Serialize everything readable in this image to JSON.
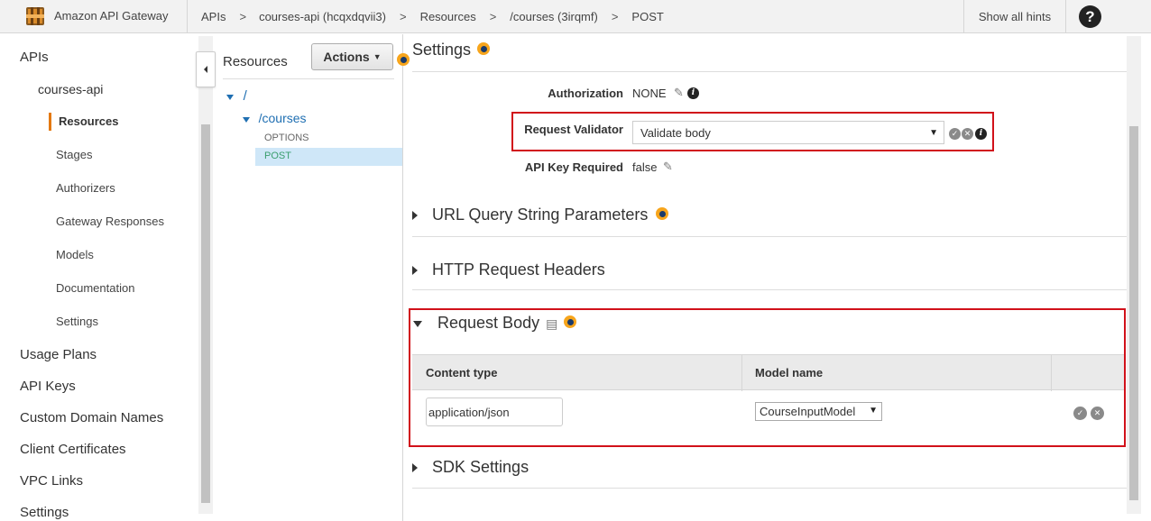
{
  "topbar": {
    "brand": "Amazon API Gateway",
    "breadcrumbs": [
      "APIs",
      "courses-api (hcqxdqvii3)",
      "Resources",
      "/courses (3irqmf)",
      "POST"
    ],
    "separator": ">",
    "show_hints": "Show all hints",
    "help": "?"
  },
  "sidebar": {
    "apis": "APIs",
    "api_name": "courses-api",
    "items": [
      "Resources",
      "Stages",
      "Authorizers",
      "Gateway Responses",
      "Models",
      "Documentation",
      "Settings"
    ],
    "sections": [
      "Usage Plans",
      "API Keys",
      "Custom Domain Names",
      "Client Certificates",
      "VPC Links",
      "Settings"
    ],
    "active": "Resources"
  },
  "tree": {
    "title": "Resources",
    "actions_label": "Actions",
    "root": "/",
    "child": "/courses",
    "methods": [
      "OPTIONS",
      "POST"
    ],
    "selected": "POST"
  },
  "settings": {
    "title": "Settings",
    "authorization_label": "Authorization",
    "authorization_value": "NONE",
    "validator_label": "Request Validator",
    "validator_value": "Validate body",
    "api_key_label": "API Key Required",
    "api_key_value": "false"
  },
  "sections": {
    "url_query": "URL Query String Parameters",
    "http_headers": "HTTP Request Headers",
    "request_body": "Request Body",
    "sdk_settings": "SDK Settings"
  },
  "request_body": {
    "columns": [
      "Content type",
      "Model name"
    ],
    "rows": [
      {
        "content_type": "application/json",
        "model_name": "CourseInputModel"
      }
    ]
  },
  "colors": {
    "accent_orange": "#e47911",
    "link_blue": "#1f6fb2",
    "highlight_red": "#d1111a",
    "selected_bg": "#cfe7f8"
  }
}
